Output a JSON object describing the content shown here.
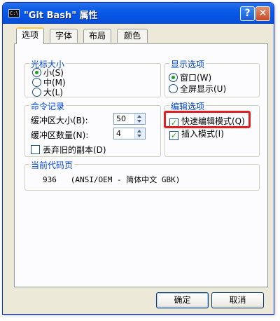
{
  "window": {
    "title": "\"Git Bash\" 属性",
    "icon": "C:\\",
    "help_label": "?",
    "close_label": "✕"
  },
  "tabs": [
    {
      "label": "选项",
      "active": true
    },
    {
      "label": "字体",
      "active": false
    },
    {
      "label": "布局",
      "active": false
    },
    {
      "label": "颜色",
      "active": false
    }
  ],
  "cursor_size": {
    "legend": "光标大小",
    "options": [
      {
        "label": "小(S)",
        "selected": true
      },
      {
        "label": "中(M)",
        "selected": false
      },
      {
        "label": "大(L)",
        "selected": false
      }
    ]
  },
  "display_options": {
    "legend": "显示选项",
    "options": [
      {
        "label": "窗口(W)",
        "selected": true
      },
      {
        "label": "全屏显示(U)",
        "selected": false
      }
    ]
  },
  "command_history": {
    "legend": "命令记录",
    "buffer_size_label": "缓冲区大小(B):",
    "buffer_size_value": "50",
    "buffer_count_label": "缓冲区数量(N):",
    "buffer_count_value": "4",
    "discard_label": "丢弃旧的副本(D)",
    "discard_checked": false
  },
  "edit_options": {
    "legend": "编辑选项",
    "quick_edit_label": "快速编辑模式(Q)",
    "quick_edit_checked": true,
    "insert_mode_label": "插入模式(I)",
    "insert_mode_checked": true
  },
  "code_page": {
    "legend": "当前代码页",
    "value": "936   (ANSI/OEM - 简体中文 GBK)"
  },
  "buttons": {
    "ok": "确定",
    "cancel": "取消"
  },
  "colors": {
    "legend_blue": "#0046d5",
    "highlight_red": "#e02020",
    "check_green": "#21a121"
  }
}
